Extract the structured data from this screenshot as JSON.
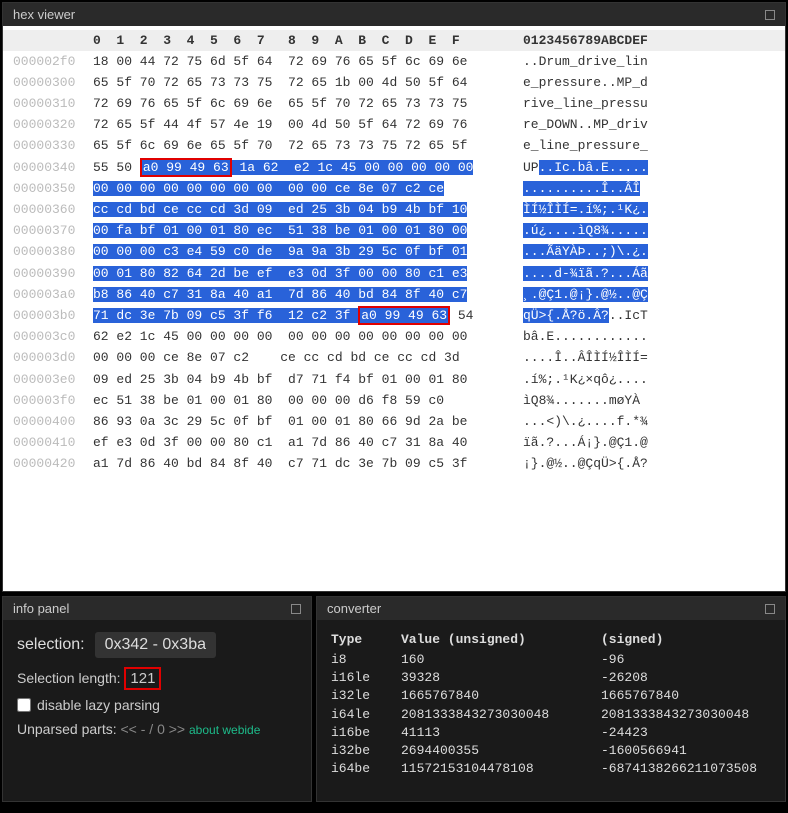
{
  "panels": {
    "hexViewer": {
      "title": "hex viewer"
    },
    "infoPanel": {
      "title": "info panel"
    },
    "converter": {
      "title": "converter"
    }
  },
  "hex": {
    "header": {
      "cols": "0  1  2  3  4  5  6  7   8  9  A  B  C  D  E  F",
      "ascii": "0123456789ABCDEF"
    },
    "rows": [
      {
        "addr": "000002f0",
        "bytes": "18 00 44 72 75 6d 5f 64  72 69 76 65 5f 6c 69 6e",
        "ascii": "..Drum_drive_lin"
      },
      {
        "addr": "00000300",
        "bytes": "65 5f 70 72 65 73 73 75  72 65 1b 00 4d 50 5f 64",
        "ascii": "e_pressure..MP_d"
      },
      {
        "addr": "00000310",
        "bytes": "72 69 76 65 5f 6c 69 6e  65 5f 70 72 65 73 73 75",
        "ascii": "rive_line_pressu"
      },
      {
        "addr": "00000320",
        "bytes": "72 65 5f 44 4f 57 4e 19  00 4d 50 5f 64 72 69 76",
        "ascii": "re_DOWN..MP_driv"
      },
      {
        "addr": "00000330",
        "bytes": "65 5f 6c 69 6e 65 5f 70  72 65 73 73 75 72 65 5f",
        "ascii": "e_line_pressure_"
      },
      {
        "addr": "00000340",
        "pre": "55 50 ",
        "red1": "a0 99 49 63",
        "sel1": " 1a 62  e2 1c 45 00 00 00 00 00",
        "apre": "UP",
        "asel": "..Ic.bâ.E....."
      },
      {
        "addr": "00000350",
        "sel": "00 00 00 00 00 00 00 00  00 00 ce 8e 07 c2 ce",
        "post": "   ",
        "asel": "..........Î..ÂÎ",
        "apost": ""
      },
      {
        "addr": "00000360",
        "sel": "cc cd bd ce cc cd 3d 09  ed 25 3b 04 b9 4b bf 10",
        "asel": "ÌÍ½ÎÌÍ=.í%;.¹K¿."
      },
      {
        "addr": "00000370",
        "sel": "00 fa bf 01 00 01 80 ec  51 38 be 01 00 01 80 00",
        "asel": ".ú¿....ìQ8¾....."
      },
      {
        "addr": "00000380",
        "sel": "00 00 00 c3 e4 59 c0 de  9a 9a 3b 29 5c 0f bf 01",
        "asel": "...ÃäYÀÞ..;)\\.¿."
      },
      {
        "addr": "00000390",
        "sel": "00 01 80 82 64 2d be ef  e3 0d 3f 00 00 80 c1 e3",
        "asel": "....d-¾ïã.?...Áã"
      },
      {
        "addr": "000003a0",
        "sel": "b8 86 40 c7 31 8a 40 a1  7d 86 40 bd 84 8f 40 c7",
        "asel": "¸.@Ç1.@¡}.@½..@Ç"
      },
      {
        "addr": "000003b0",
        "sel": "71 dc 3e 7b 09 c5 3f f6  12 c2 3f ",
        "red2": "a0 99 49 63",
        "post": " 54",
        "asel": "qÜ>{.Å?ö.Â?",
        "apost": "..IcT"
      },
      {
        "addr": "000003c0",
        "bytes": "62 e2 1c 45 00 00 00 00  00 00 00 00 00 00 00 00",
        "ascii": "bâ.E............"
      },
      {
        "addr": "000003d0",
        "bytes": "00 00 00 ce 8e 07 c2    ce cc cd bd ce cc cd 3d",
        "ascii": "....Î..ÂÎÌÍ½ÎÌÍ="
      },
      {
        "addr": "000003e0",
        "bytes": "09 ed 25 3b 04 b9 4b bf  d7 71 f4 bf 01 00 01 80",
        "ascii": ".í%;.¹K¿×qô¿...."
      },
      {
        "addr": "000003f0",
        "bytes": "ec 51 38 be 01 00 01 80  00 00 00 d6 f8 59 c0   ",
        "ascii": "ìQ8¾.......møYÀ"
      },
      {
        "addr": "00000400",
        "bytes": "86 93 0a 3c 29 5c 0f bf  01 00 01 80 66 9d 2a be",
        "ascii": "...<)\\.¿....f.*¾"
      },
      {
        "addr": "00000410",
        "bytes": "ef e3 0d 3f 00 00 80 c1  a1 7d 86 40 c7 31 8a 40",
        "ascii": "ïã.?...Á¡}.@Ç1.@"
      },
      {
        "addr": "00000420",
        "bytes": "a1 7d 86 40 bd 84 8f 40  c7 71 dc 3e 7b 09 c5 3f",
        "ascii": "¡}.@½..@ÇqÜ>{.Å?"
      }
    ]
  },
  "info": {
    "selectionLabel": "selection:",
    "selectionValue": "0x342  - 0x3ba",
    "selLenLabel": "Selection length:",
    "selLenValue": "121",
    "lazyLabel": "disable lazy parsing",
    "unparsedLabel": "Unparsed parts:",
    "unparsedNav": "<< - / 0 >>",
    "aboutLabel": "about webide"
  },
  "converter": {
    "headers": {
      "type": "Type",
      "uval": "Value (unsigned)",
      "sval": "(signed)"
    },
    "rows": [
      {
        "type": "i8",
        "u": "160",
        "s": "-96"
      },
      {
        "type": "i16le",
        "u": "39328",
        "s": "-26208"
      },
      {
        "type": "i32le",
        "u": "1665767840",
        "s": "1665767840"
      },
      {
        "type": "i64le",
        "u": "2081333843273030048",
        "s": "2081333843273030048"
      },
      {
        "type": "i16be",
        "u": "41113",
        "s": "-24423"
      },
      {
        "type": "i32be",
        "u": "2694400355",
        "s": "-1600566941"
      },
      {
        "type": "i64be",
        "u": "11572153104478108",
        "s": "-6874138266211073508"
      }
    ]
  }
}
